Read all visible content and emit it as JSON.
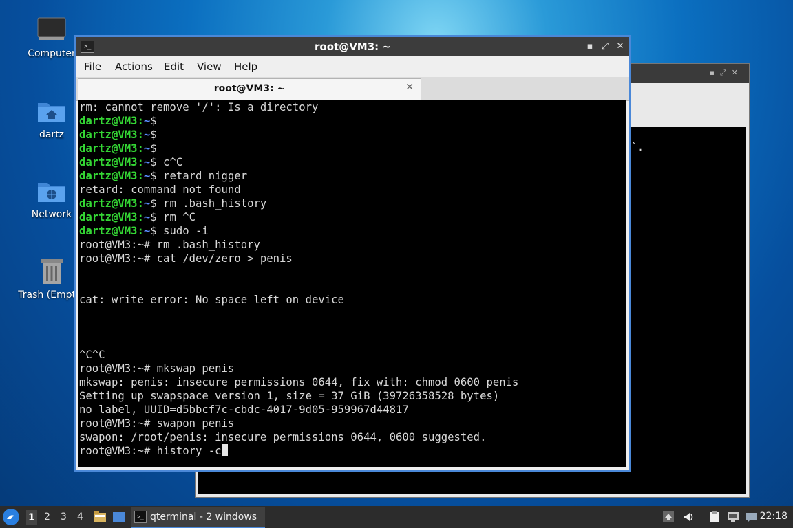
{
  "desktop": {
    "icons": [
      {
        "label": "Computer"
      },
      {
        "label": "dartz"
      },
      {
        "label": "Network"
      },
      {
        "label": "Trash (Empty)"
      }
    ]
  },
  "back_window": {
    "fragment": "`."
  },
  "window": {
    "title": "root@VM3: ~",
    "minimize_glyph": "▪",
    "maximize_glyph": "⤢",
    "close_glyph": "✕",
    "menu": [
      "File",
      "Actions",
      "Edit",
      "View",
      "Help"
    ],
    "tab": {
      "title": "root@VM3: ~",
      "close_glyph": "✕"
    }
  },
  "terminal": {
    "lines": [
      {
        "text": "rm: cannot remove '/': Is a directory"
      },
      {
        "user": "dartz@VM3",
        "path": "~",
        "cmd": "$"
      },
      {
        "user": "dartz@VM3",
        "path": "~",
        "cmd": "$"
      },
      {
        "user": "dartz@VM3",
        "path": "~",
        "cmd": "$"
      },
      {
        "user": "dartz@VM3",
        "path": "~",
        "cmd": "$ c^C"
      },
      {
        "user": "dartz@VM3",
        "path": "~",
        "cmd": "$ retard nigger"
      },
      {
        "text": "retard: command not found"
      },
      {
        "user": "dartz@VM3",
        "path": "~",
        "cmd": "$ rm .bash_history"
      },
      {
        "user": "dartz@VM3",
        "path": "~",
        "cmd": "$ rm ^C"
      },
      {
        "user": "dartz@VM3",
        "path": "~",
        "cmd": "$ sudo -i"
      },
      {
        "text": "root@VM3:~# rm .bash_history"
      },
      {
        "text": "root@VM3:~# cat /dev/zero > penis"
      },
      {
        "text": ""
      },
      {
        "text": ""
      },
      {
        "text": "cat: write error: No space left on device"
      },
      {
        "text": ""
      },
      {
        "text": ""
      },
      {
        "text": ""
      },
      {
        "text": "^C^C"
      },
      {
        "text": "root@VM3:~# mkswap penis"
      },
      {
        "text": "mkswap: penis: insecure permissions 0644, fix with: chmod 0600 penis"
      },
      {
        "text": "Setting up swapspace version 1, size = 37 GiB (39726358528 bytes)"
      },
      {
        "text": "no label, UUID=d5bbcf7c-cbdc-4017-9d05-959967d44817"
      },
      {
        "text": "root@VM3:~# swapon penis"
      },
      {
        "text": "swapon: /root/penis: insecure permissions 0644, 0600 suggested."
      },
      {
        "text": "root@VM3:~# history -c",
        "cursor": true
      }
    ]
  },
  "taskbar": {
    "workspaces": [
      "1",
      "2",
      "3",
      "4"
    ],
    "active_workspace": "1",
    "task_label": "qterminal - 2 windows",
    "clock": "22:18"
  },
  "colors": {
    "prompt_user": "#34d634",
    "prompt_path": "#5a8cff",
    "accent": "#4a88d8"
  }
}
